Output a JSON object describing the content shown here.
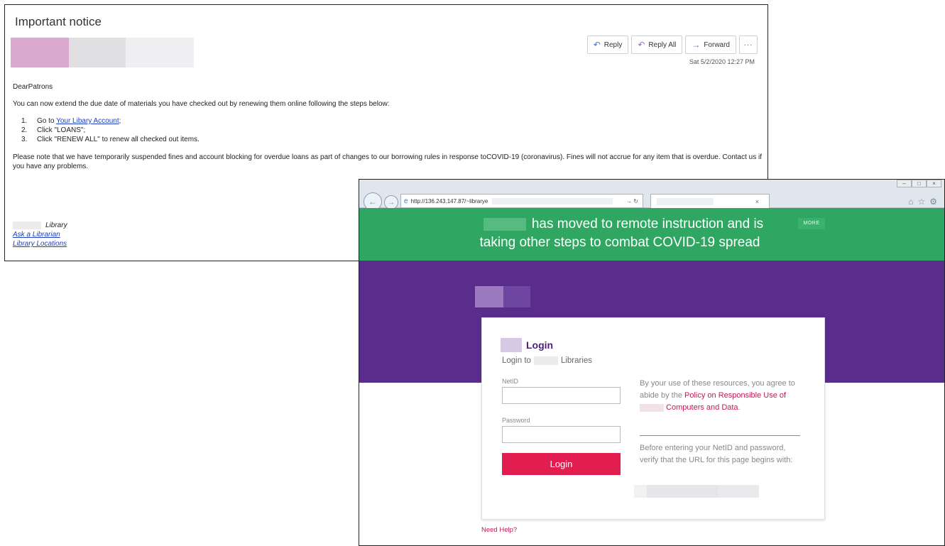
{
  "email": {
    "subject": "Important notice",
    "actions": {
      "reply": "Reply",
      "reply_all": "Reply All",
      "forward": "Forward",
      "more": "···"
    },
    "date": "Sat 5/2/2020 12:27 PM",
    "greeting": "DearPatrons",
    "intro": "You can now extend the due date of materials you have checked out by renewing them online following the steps below:",
    "steps": [
      {
        "num": "1.",
        "prefix": "Go to ",
        "link": "Your Libary Account",
        "suffix": ";"
      },
      {
        "num": "2.",
        "text": "Click \"LOANS\";"
      },
      {
        "num": "3.",
        "text": "Click \"RENEW ALL\" to renew all checked out items."
      }
    ],
    "notice": "Please note that we have temporarily suspended fines and account blocking for overdue loans as part of changes to our borrowing rules in response toCOVID-19 (coronavirus). Fines will not accrue for any item that is overdue. Contact us if you have any problems.",
    "signature": {
      "library": "Library",
      "ask": "Ask a Librarian",
      "locations": "Library Locations"
    }
  },
  "browser": {
    "address": "http://136.243.147.87/~librarye",
    "address_controls": "→ ↻",
    "tab_close": "×",
    "window_buttons": [
      "–",
      "□",
      "×"
    ],
    "toolbar_icons": [
      "⌂",
      "☆",
      "⚙"
    ],
    "banner": {
      "line1": "has moved to remote instruction and is",
      "line2": "taking other steps to combat COVID-19 spread",
      "more": "MORE"
    },
    "login": {
      "title": "Login",
      "subtitle_prefix": "Login to",
      "subtitle_suffix": "Libraries",
      "netid_label": "NetID",
      "password_label": "Password",
      "button": "Login",
      "policy_prefix": "By your use of these resources, you agree to abide by the ",
      "policy_link_a": "Policy on Responsible Use of ",
      "policy_link_b": " Computers and Data",
      "policy_suffix": ".",
      "verify": "Before entering your NetID and password, verify that the URL for this page begins with:",
      "need_help": "Need Help?"
    }
  }
}
